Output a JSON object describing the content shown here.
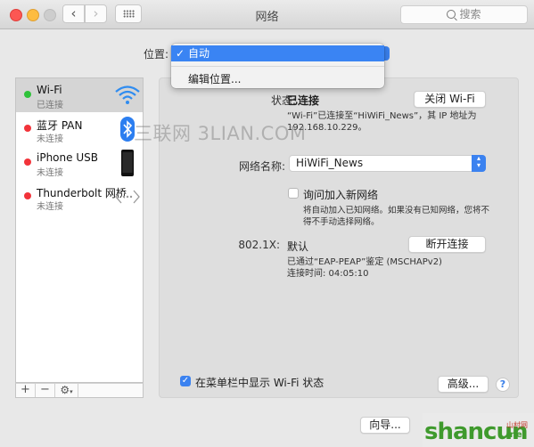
{
  "window": {
    "title": "网络",
    "search_placeholder": "搜索"
  },
  "location": {
    "label": "位置:",
    "options": [
      {
        "label": "自动",
        "selected": true
      },
      {
        "label": "编辑位置..."
      }
    ]
  },
  "services": [
    {
      "name": "Wi-Fi",
      "status": "已连接",
      "status_color": "#2fc23a",
      "icon": "wifi-icon",
      "selected": true
    },
    {
      "name": "蓝牙 PAN",
      "status": "未连接",
      "status_color": "#f2333a",
      "icon": "bluetooth-icon"
    },
    {
      "name": "iPhone USB",
      "status": "未连接",
      "status_color": "#f2333a",
      "icon": "iphone-icon"
    },
    {
      "name": "Thunderbolt 网桥",
      "status": "未连接",
      "status_color": "#f2333a",
      "icon": "thunderbolt-bridge-icon"
    }
  ],
  "sidebar_tools": {
    "add": "+",
    "remove": "−",
    "gear": "⚙"
  },
  "detail": {
    "status_label": "状态:",
    "status_value": "已连接",
    "toggle_wifi_button": "关闭 Wi-Fi",
    "status_desc_line1": "“Wi-Fi”已连接至“HiWiFi_News”，其 IP 地址为",
    "status_desc_line2": "192.168.10.229。",
    "network_name_label": "网络名称:",
    "network_name_value": "HiWiFi_News",
    "ask_join_label": "询问加入新网络",
    "ask_join_checked": false,
    "ask_join_desc_line1": "将自动加入已知网络。如果没有已知网络，您将不",
    "ask_join_desc_line2": "得不手动选择网络。",
    "dot1x_label": "802.1X:",
    "dot1x_value": "默认",
    "disconnect_button": "断开连接",
    "dot1x_desc_line1": "已通过“EAP-PEAP”鉴定 (MSCHAPv2)",
    "dot1x_desc_line2": "连接时间: 04:05:10",
    "show_in_menubar_label": "在菜单栏中显示 Wi-Fi 状态",
    "show_in_menubar_checked": true,
    "advanced_button": "高级...",
    "help": "?"
  },
  "footer": {
    "assistant_button": "向导..."
  },
  "watermark": "三联网 3LIAN.COM",
  "logo": {
    "text": "shancun",
    "cn": "山村网",
    "net": ".net"
  }
}
